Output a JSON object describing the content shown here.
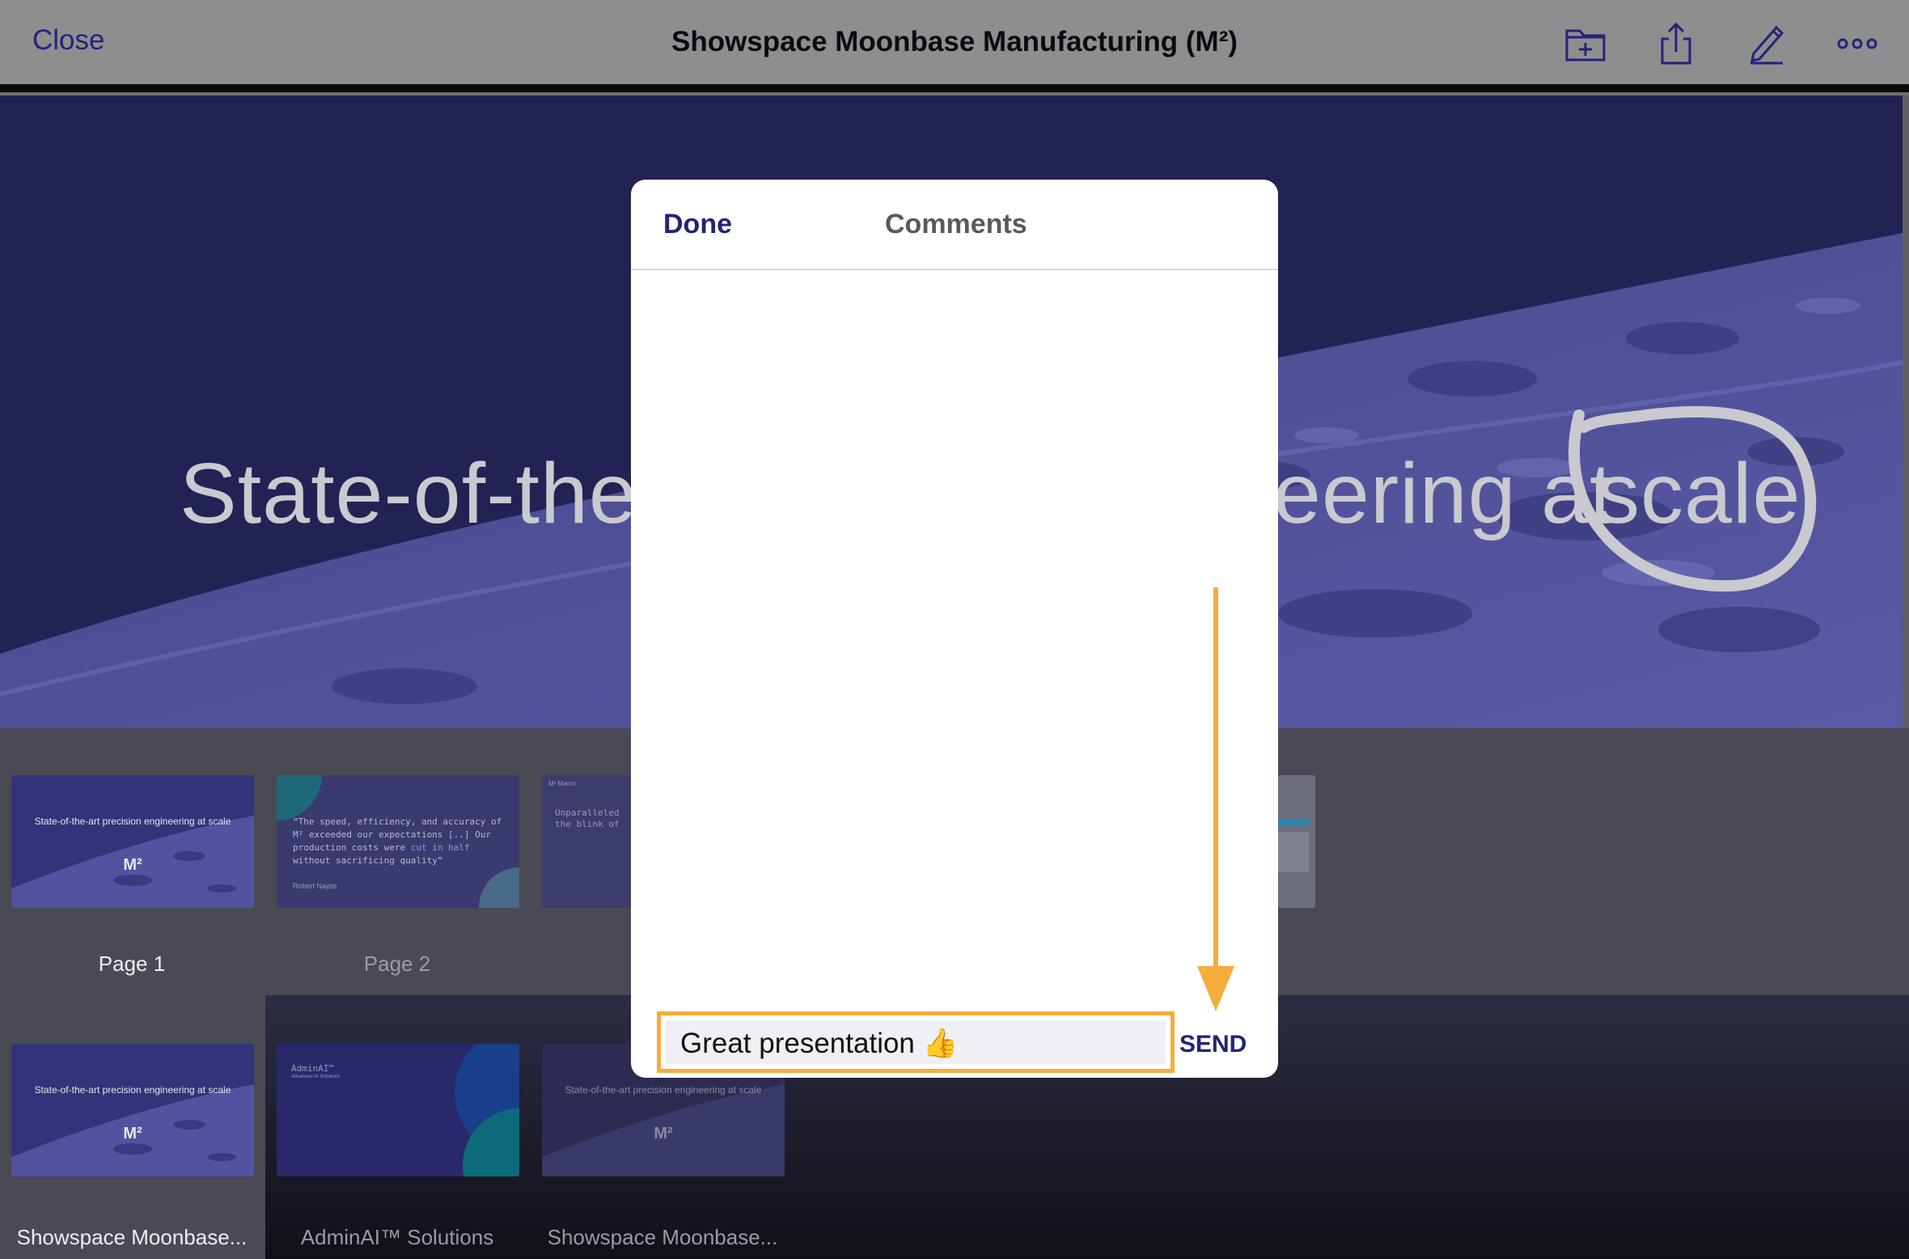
{
  "topbar": {
    "close_label": "Close",
    "title": "Showspace Moonbase Manufacturing (M²)",
    "icons": [
      "new-folder-icon",
      "share-icon",
      "pencil-icon",
      "more-icon"
    ]
  },
  "slide": {
    "text_left": "State-of-the-a",
    "text_mid": "eering at",
    "text_circled": "scale",
    "background_color": "#222255"
  },
  "thumbnails": {
    "row1": [
      {
        "label": "Page 1",
        "title": "State-of-the-art precision engineering at scale",
        "mark": "M²"
      },
      {
        "label": "Page 2",
        "quote_pre": "“The speed, efficiency, and accuracy of M² exceeded our expectations [..] Our production costs were ",
        "quote_hl": "cut in half",
        "quote_post": " without sacrificing quality”",
        "author": "Robert Nayss"
      },
      {
        "tag": "M² Macro",
        "text": "Unparalleled the blink of"
      }
    ],
    "row2": [
      {
        "label": "Showspace Moonbase...",
        "title": "State-of-the-art precision engineering at scale",
        "mark": "M²"
      },
      {
        "label": "AdminAI™ Solutions",
        "title": "AdminAI™",
        "subtitle": "Advanced AI Solutions"
      },
      {
        "label": "Showspace Moonbase...",
        "title": "State-of-the-art precision engineering at scale",
        "mark": "M²"
      }
    ]
  },
  "dialog": {
    "done_label": "Done",
    "title": "Comments",
    "input_value": "Great presentation 👍",
    "send_label": "SEND"
  },
  "colors": {
    "accent": "#23237a",
    "highlight": "#f5ad3c"
  }
}
